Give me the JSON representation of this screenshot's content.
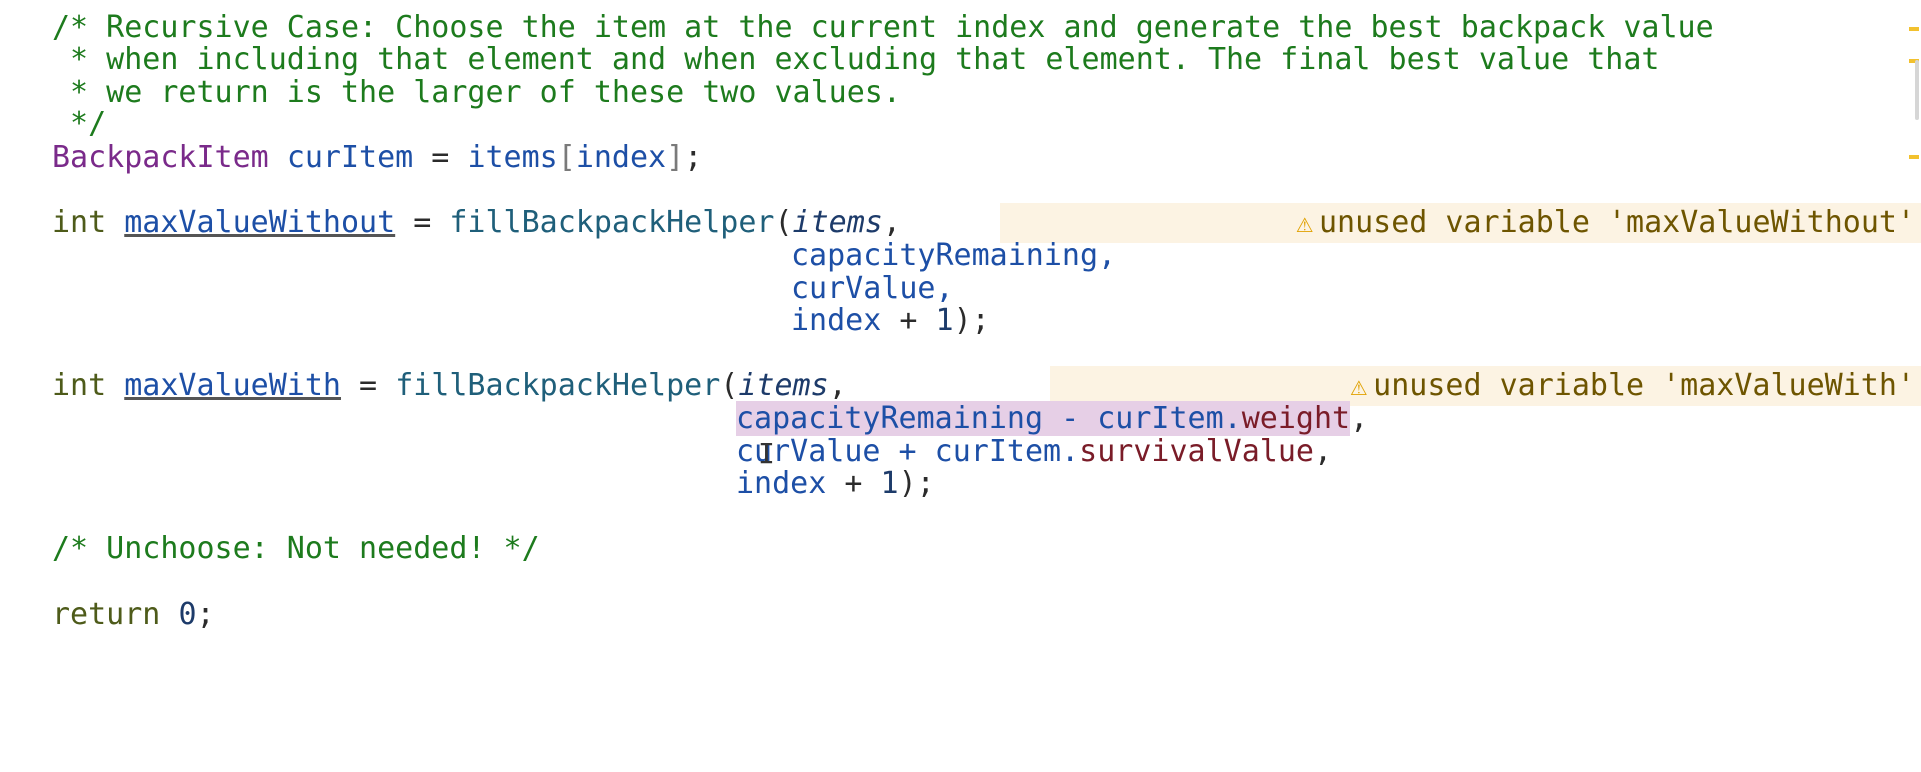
{
  "comment_lines": [
    "/* Recursive Case: Choose the item at the current index and generate the best backpack value",
    " * when including that element and when excluding that element. The final best value that",
    " * we return is the larger of these two values.",
    " */"
  ],
  "curitem_line": {
    "type": "BackpackItem",
    "name": "curItem",
    "assign": " = ",
    "array": "items",
    "open": "[",
    "index": "index",
    "close": "]",
    "end": ";"
  },
  "without_block": {
    "kw": "int",
    "var": "maxValueWithout",
    "assign": " = ",
    "func": "fillBackpackHelper",
    "open": "(",
    "arg1": "items",
    "comma": ",",
    "arg2": "capacityRemaining,",
    "arg3": "curValue,",
    "arg4_var": "index",
    "arg4_plus": " + ",
    "arg4_num": "1",
    "arg4_end": ");",
    "warning": "unused variable 'maxValueWithout'"
  },
  "with_block": {
    "kw": "int",
    "var": "maxValueWith",
    "assign": " = ",
    "func": "fillBackpackHelper",
    "open": "(",
    "arg1": "items",
    "comma": ",",
    "arg2_sel_a": "capacityRemaining - curItem.",
    "arg2_sel_b": "weight",
    "arg2_end": ",",
    "arg3_a": "curValue + curItem.",
    "arg3_field": "survivalValue",
    "arg3_end": ",",
    "arg4_var": "index",
    "arg4_plus": " + ",
    "arg4_num": "1",
    "arg4_end": ");",
    "warning": "unused variable 'maxValueWith'"
  },
  "unchoose_comment": "/* Unchoose: Not needed! */",
  "return_line": {
    "kw": "return",
    "space": " ",
    "num": "0",
    "end": ";"
  },
  "icons": {
    "warning": "warning-triangle-icon",
    "cursor": "text-cursor-icon"
  },
  "colors": {
    "comment": "#1d7b1d",
    "type": "#7a2a8a",
    "warning_bg": "#fcf3e3",
    "selection": "#e6cfe6",
    "marker": "#f2c12e"
  }
}
